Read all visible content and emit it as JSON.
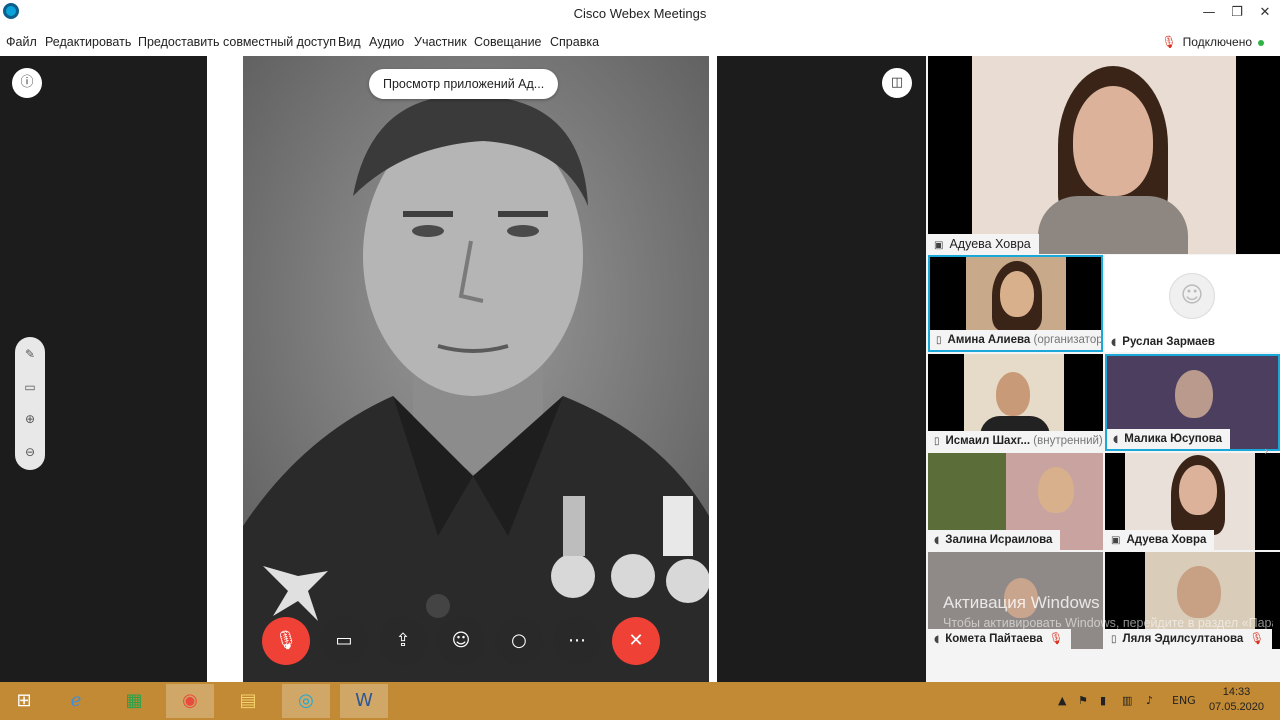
{
  "window": {
    "title": "Cisco Webex Meetings"
  },
  "menu": {
    "items": [
      "Файл",
      "Редактировать",
      "Предоставить совместный доступ",
      "Вид",
      "Аудио",
      "Участник",
      "Совещание",
      "Справка"
    ],
    "status": "Подключено"
  },
  "stage": {
    "view_pill": "Просмотр приложений Ад...",
    "controls": [
      "mute-icon",
      "video-icon",
      "share-icon",
      "participants-icon",
      "chat-icon",
      "more-icon",
      "end-call-icon"
    ]
  },
  "participants": {
    "active_speaker": "Адуева Ховра",
    "tiles": [
      {
        "name": "Амина Алиева",
        "sub": "(организатор)"
      },
      {
        "name": "Руслан Зармаев",
        "sub": ""
      },
      {
        "name": "Исмаил Шахг...",
        "sub": "(внутренний)"
      },
      {
        "name": "Малика Юсупова",
        "sub": ""
      },
      {
        "name": "Залина Исраилова",
        "sub": ""
      },
      {
        "name": "Адуева Ховра",
        "sub": ""
      },
      {
        "name": "Комета Пайтаева",
        "sub": ""
      },
      {
        "name": "Ляля Эдилсултанова",
        "sub": ""
      }
    ]
  },
  "watermark": {
    "title": "Активация Windows",
    "text": "Чтобы активировать Windows, перейдите в раздел «Параметры компьютера»."
  },
  "taskbar": {
    "lang": "ENG",
    "time": "14:33",
    "date": "07.05.2020"
  }
}
